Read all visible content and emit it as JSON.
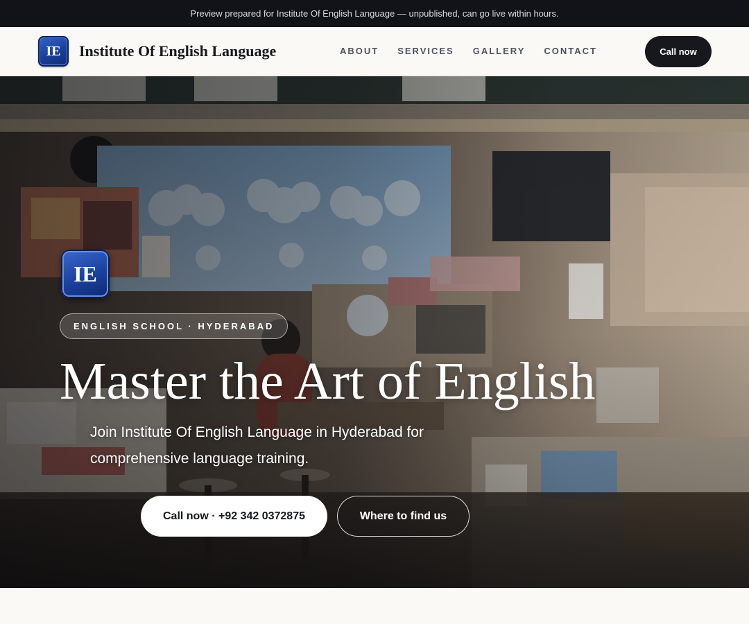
{
  "preview_banner": {
    "text": "Preview prepared for Institute Of English Language — unpublished, can go live within hours."
  },
  "header": {
    "logo_text": "IE",
    "brand_name": "Institute Of English Language",
    "nav": [
      {
        "label": "ABOUT"
      },
      {
        "label": "SERVICES"
      },
      {
        "label": "GALLERY"
      },
      {
        "label": "CONTACT"
      }
    ],
    "cta_label": "Call now"
  },
  "hero": {
    "logo_text": "IE",
    "badge": "ENGLISH SCHOOL · HYDERABAD",
    "title": "Master the Art of English",
    "subtitle": "Join Institute Of English Language in Hyderabad for comprehensive language training.",
    "primary_button": "Call now · +92 342 0372875",
    "secondary_button": "Where to find us"
  },
  "colors": {
    "banner_bg": "#111318",
    "header_bg": "#faf9f6",
    "dark_button": "#16181d",
    "logo_blue": "#1a3f9a",
    "nav_text": "#4d5160"
  },
  "icons": {
    "logo": "ie-logo-icon"
  }
}
